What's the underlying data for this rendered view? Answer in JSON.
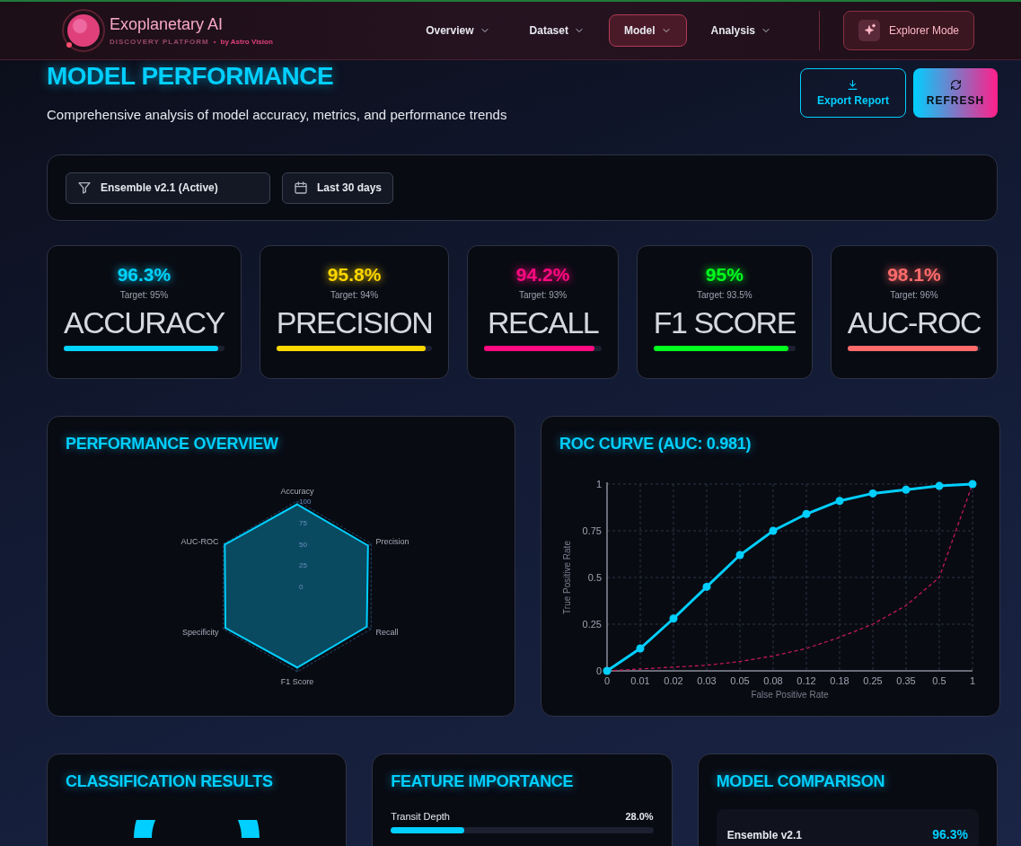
{
  "header": {
    "title": "Exoplanetary AI",
    "subtitle": "DISCOVERY PLATFORM",
    "separator": "•",
    "byline": "by Astro Vision",
    "nav": [
      {
        "label": "Overview",
        "selected": false
      },
      {
        "label": "Dataset",
        "selected": false
      },
      {
        "label": "Model",
        "selected": true
      },
      {
        "label": "Analysis",
        "selected": false
      }
    ],
    "mode_button": "Explorer Mode"
  },
  "page": {
    "title": "MODEL PERFORMANCE",
    "subtitle": "Comprehensive analysis of model accuracy, metrics, and performance trends",
    "buttons": [
      {
        "label": "Export Report",
        "kind": "export"
      },
      {
        "label": "REFRESH",
        "kind": "refresh"
      }
    ]
  },
  "filters": [
    {
      "kind": "model",
      "value": "Ensemble v2.1 (Active)"
    },
    {
      "kind": "date",
      "value": "Last 30 days"
    }
  ],
  "metrics": [
    {
      "value": "96.3%",
      "target": "Target: 95%",
      "label": "ACCURACY",
      "level": 0.963,
      "color": "#00d4ff"
    },
    {
      "value": "95.8%",
      "target": "Target: 94%",
      "label": "PRECISION",
      "level": 0.958,
      "color": "#ffd700"
    },
    {
      "value": "94.2%",
      "target": "Target: 93%",
      "label": "RECALL",
      "level": 0.942,
      "color": "#ff0a80"
    },
    {
      "value": "95%",
      "target": "Target: 93.5%",
      "label": "F1 SCORE",
      "level": 0.95,
      "color": "#00ff1e"
    },
    {
      "value": "98.1%",
      "target": "Target: 96%",
      "label": "AUC-ROC",
      "level": 0.981,
      "color": "#ff6b6b"
    }
  ],
  "performance_overview": {
    "title": "PERFORMANCE OVERVIEW",
    "chart_data": {
      "type": "radar",
      "categories": [
        "Accuracy",
        "Precision",
        "Recall",
        "F1 Score",
        "Specificity",
        "AUC-ROC"
      ],
      "values": [
        96.3,
        95.8,
        94.2,
        95,
        97.2,
        98.1
      ],
      "ylim": [
        0,
        100
      ],
      "yticks": [
        0,
        25,
        50,
        75,
        100
      ]
    }
  },
  "roc_curve": {
    "title": "ROC CURVE (AUC: 0.981)",
    "chart_data": {
      "type": "line",
      "xlabel": "False Positive Rate",
      "ylabel": "True Positive Rate",
      "grid": true,
      "categories": [
        "0",
        "0.01",
        "0.02",
        "0.03",
        "0.05",
        "0.08",
        "0.12",
        "0.18",
        "0.25",
        "0.35",
        "0.5",
        "1"
      ],
      "ylim": [
        0,
        1
      ],
      "yticks": [
        0,
        0.25,
        0.5,
        0.75,
        1
      ],
      "series": [
        {
          "color": "#00cfff",
          "marker": "circle",
          "values": [
            0,
            0.12,
            0.28,
            0.45,
            0.62,
            0.75,
            0.84,
            0.91,
            0.95,
            0.97,
            0.99,
            1
          ]
        },
        {
          "color": "#c2185b",
          "line_style": "dashed",
          "values": [
            0,
            0.01,
            0.02,
            0.03,
            0.05,
            0.08,
            0.12,
            0.18,
            0.25,
            0.35,
            0.5,
            1
          ]
        }
      ]
    }
  },
  "classification_results": {
    "title": "CLASSIFICATION RESULTS"
  },
  "feature_importance": {
    "title": "FEATURE IMPORTANCE",
    "features": [
      {
        "name": "Transit Depth",
        "value": "28.0%",
        "level": 0.28
      }
    ]
  },
  "model_comparison": {
    "title": "MODEL COMPARISON",
    "models": [
      {
        "name": "Ensemble v2.1",
        "value": "96.3%"
      }
    ]
  }
}
